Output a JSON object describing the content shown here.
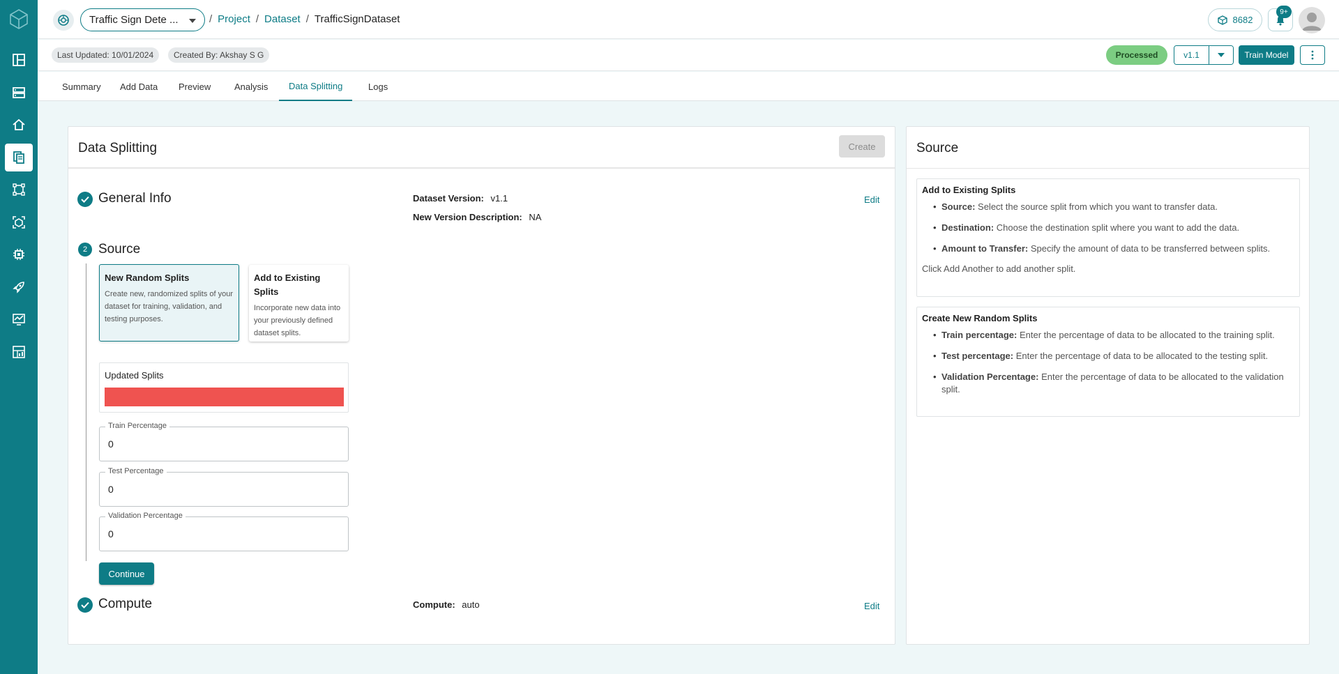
{
  "header": {
    "project_select": "Traffic Sign Dete ...",
    "breadcrumbs": {
      "sep": "/",
      "project": "Project",
      "dataset": "Dataset",
      "current": "TrafficSignDataset"
    },
    "credits": "8682",
    "notifications_badge": "9+"
  },
  "meta": {
    "last_updated": "Last Updated: 10/01/2024",
    "created_by": "Created By: Akshay S G",
    "status": "Processed",
    "version": "v1.1",
    "train_model": "Train Model"
  },
  "tabs": [
    "Summary",
    "Add Data",
    "Preview",
    "Analysis",
    "Data Splitting",
    "Logs"
  ],
  "main": {
    "title": "Data Splitting",
    "create_label": "Create",
    "general_info": {
      "title": "General Info",
      "dataset_version_label": "Dataset Version:",
      "dataset_version_value": "v1.1",
      "description_label": "New Version Description:",
      "description_value": "NA",
      "edit": "Edit"
    },
    "source": {
      "step": "2",
      "title": "Source",
      "options": [
        {
          "title": "New Random Splits",
          "desc": "Create new, randomized splits of your dataset for training, validation, and testing purposes."
        },
        {
          "title": "Add to Existing Splits",
          "desc": "Incorporate new data into your previously defined dataset splits."
        }
      ],
      "updated_splits_label": "Updated Splits",
      "fields": [
        {
          "label": "Train Percentage",
          "value": "0"
        },
        {
          "label": "Test Percentage",
          "value": "0"
        },
        {
          "label": "Validation Percentage",
          "value": "0"
        }
      ],
      "continue": "Continue"
    },
    "compute": {
      "title": "Compute",
      "label": "Compute:",
      "value": "auto",
      "edit": "Edit"
    }
  },
  "side": {
    "title": "Source",
    "sections": [
      {
        "title": "Add to Existing Splits",
        "items": [
          {
            "key": "Source:",
            "text": "Select the source split from which you want to transfer data."
          },
          {
            "key": "Destination:",
            "text": "Choose the destination split where you want to add the data."
          },
          {
            "key": "Amount to Transfer:",
            "text": "Specify the amount of data to be transferred between splits."
          }
        ],
        "note": "Click Add Another to add another split."
      },
      {
        "title": "Create New Random Splits",
        "items": [
          {
            "key": "Train percentage:",
            "text": "Enter the percentage of data to be allocated to the training split."
          },
          {
            "key": "Test percentage:",
            "text": "Enter the percentage of data to be allocated to the testing split."
          },
          {
            "key": "Validation Percentage:",
            "text": "Enter the percentage of data to be allocated to the validation split."
          }
        ]
      }
    ]
  },
  "colors": {
    "brand": "#0e7c86",
    "processed": "#7ccd82",
    "split_bar": "#ef5350"
  }
}
